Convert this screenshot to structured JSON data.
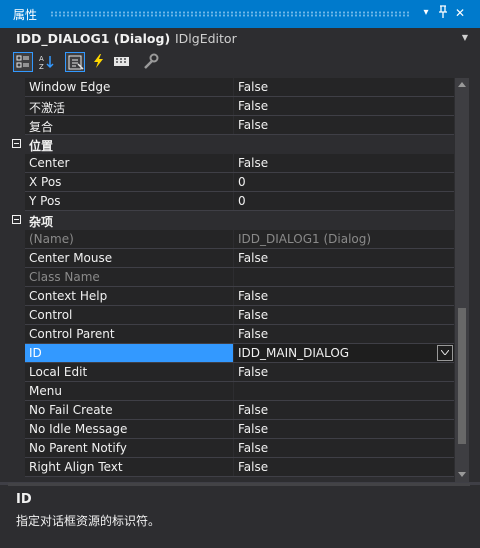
{
  "panel": {
    "title": "属性",
    "buttons": {
      "menu": "▾",
      "pin": "⊥",
      "close": "✕"
    }
  },
  "object_selector": {
    "name": "IDD_DIALOG1 (Dialog)",
    "type": "IDlgEditor"
  },
  "toolbar": {
    "tools": [
      "categorized-icon",
      "alphabetical-icon",
      "properties-icon",
      "events-icon",
      "messages-icon",
      "overrides-icon"
    ]
  },
  "rows": [
    {
      "kind": "prop",
      "name": "Window Edge",
      "value": "False"
    },
    {
      "kind": "prop",
      "name": "不激活",
      "value": "False"
    },
    {
      "kind": "prop",
      "name": "复合",
      "value": "False"
    },
    {
      "kind": "cat",
      "name": "位置"
    },
    {
      "kind": "prop",
      "name": "Center",
      "value": "False"
    },
    {
      "kind": "prop",
      "name": "X Pos",
      "value": "0"
    },
    {
      "kind": "prop",
      "name": "Y Pos",
      "value": "0"
    },
    {
      "kind": "cat",
      "name": "杂项"
    },
    {
      "kind": "prop",
      "name": "(Name)",
      "value": "IDD_DIALOG1 (Dialog)",
      "disabled": true
    },
    {
      "kind": "prop",
      "name": "Center Mouse",
      "value": "False"
    },
    {
      "kind": "prop",
      "name": "Class Name",
      "value": "",
      "disabled": true
    },
    {
      "kind": "prop",
      "name": "Context Help",
      "value": "False"
    },
    {
      "kind": "prop",
      "name": "Control",
      "value": "False"
    },
    {
      "kind": "prop",
      "name": "Control Parent",
      "value": "False"
    },
    {
      "kind": "prop",
      "name": "ID",
      "value": "IDD_MAIN_DIALOG",
      "selected": true
    },
    {
      "kind": "prop",
      "name": "Local Edit",
      "value": "False"
    },
    {
      "kind": "prop",
      "name": "Menu",
      "value": ""
    },
    {
      "kind": "prop",
      "name": "No Fail Create",
      "value": "False"
    },
    {
      "kind": "prop",
      "name": "No Idle Message",
      "value": "False"
    },
    {
      "kind": "prop",
      "name": "No Parent Notify",
      "value": "False"
    },
    {
      "kind": "prop",
      "name": "Right Align Text",
      "value": "False"
    }
  ],
  "description": {
    "title": "ID",
    "text": "指定对话框资源的标识符。"
  },
  "colors": {
    "accent": "#007acc",
    "selection": "#3399ff",
    "background": "#2d2d30",
    "grid": "#252526"
  }
}
